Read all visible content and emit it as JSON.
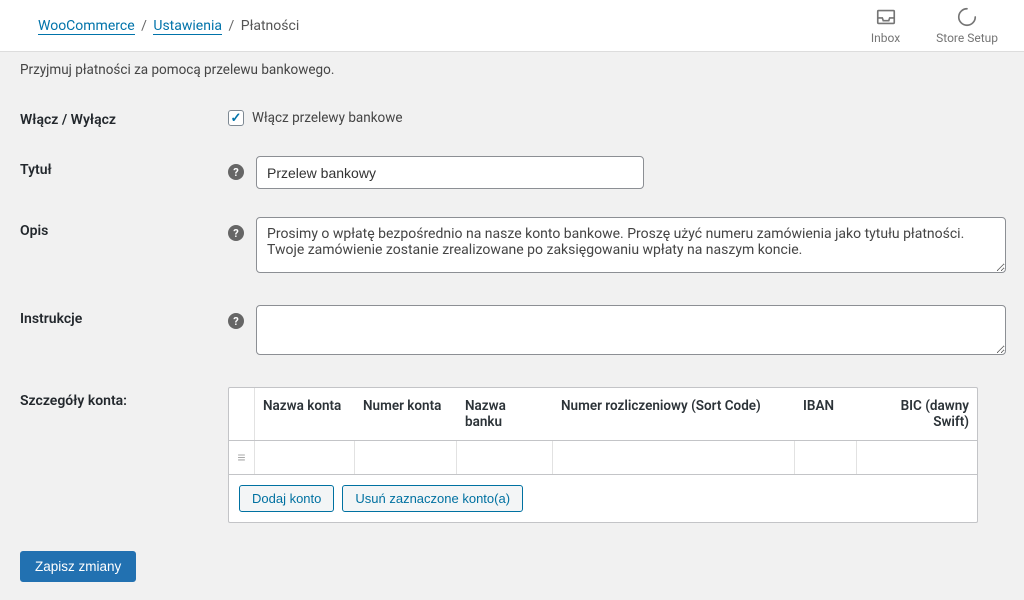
{
  "breadcrumb": {
    "level1": "WooCommerce",
    "level2": "Ustawienia",
    "level3": "Płatności"
  },
  "header_icons": {
    "inbox": "Inbox",
    "store_setup": "Store Setup"
  },
  "description": "Przyjmuj płatności za pomocą przelewu bankowego.",
  "fields": {
    "enable": {
      "label": "Włącz / Wyłącz",
      "checkbox_label": "Włącz przelewy bankowe",
      "checked": true
    },
    "title": {
      "label": "Tytuł",
      "value": "Przelew bankowy"
    },
    "desc": {
      "label": "Opis",
      "value": "Prosimy o wpłatę bezpośrednio na nasze konto bankowe. Proszę użyć numeru zamówienia jako tytułu płatności. Twoje zamówienie zostanie zrealizowane po zaksięgowaniu wpłaty na naszym koncie."
    },
    "instructions": {
      "label": "Instrukcje",
      "value": ""
    },
    "accounts": {
      "label": "Szczegóły konta:",
      "headers": {
        "name": "Nazwa konta",
        "number": "Numer konta",
        "bank": "Nazwa banku",
        "sort": "Numer rozliczeniowy (Sort Code)",
        "iban": "IBAN",
        "bic": "BIC (dawny Swift)"
      },
      "buttons": {
        "add": "Dodaj konto",
        "remove": "Usuń zaznaczone konto(a)"
      }
    }
  },
  "submit_label": "Zapisz zmiany",
  "help_glyph": "?"
}
